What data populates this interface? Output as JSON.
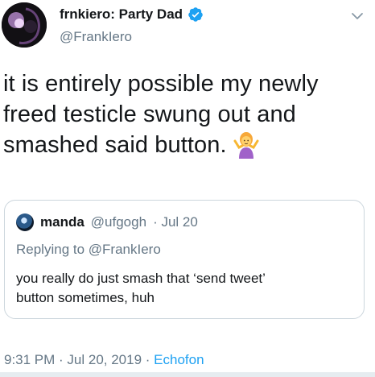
{
  "tweet": {
    "author": {
      "display_name": "frnkiero: Party Dad",
      "handle": "@FrankIero",
      "verified": true
    },
    "text_line1": "it is entirely possible my newly",
    "text_line2": "freed testicle swung out and",
    "text_line3": "smashed said button.",
    "emoji": "person-shrugging",
    "timestamp": "9:31 PM · Jul 20, 2019",
    "source_separator": " · ",
    "source": "Echofon"
  },
  "quote": {
    "display_name": "manda",
    "handle": "@ufgogh",
    "date": "· Jul 20",
    "replying_to": "Replying to @FrankIero",
    "text_line1": "you really do just smash that ‘send tweet’",
    "text_line2": "button sometimes, huh"
  },
  "colors": {
    "text": "#14171a",
    "secondary": "#657786",
    "accent": "#1da1f2",
    "border": "#ccd6dd"
  }
}
